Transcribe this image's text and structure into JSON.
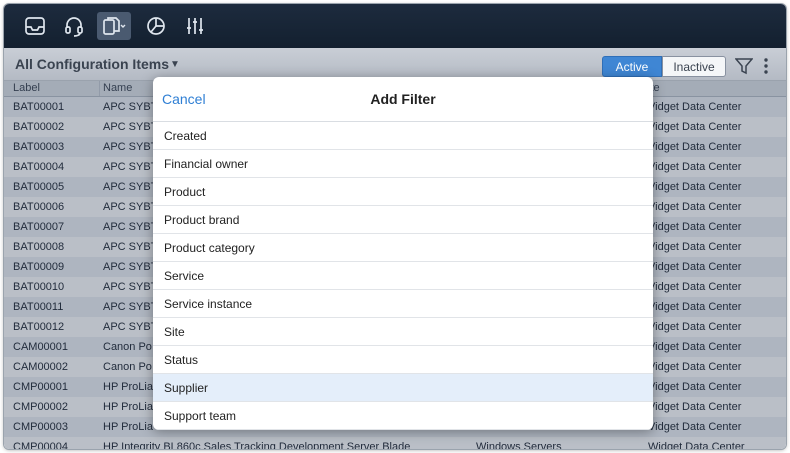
{
  "toolbar": {
    "icons": [
      "inbox-icon",
      "headset-icon",
      "copy-icon",
      "pie-chart-icon",
      "sliders-icon"
    ],
    "active_icon": "copy-icon"
  },
  "header": {
    "title": "All Configuration Items",
    "caret": "▼",
    "active_label": "Active",
    "inactive_label": "Inactive"
  },
  "table": {
    "columns": [
      "Label",
      "Name",
      "",
      "ite"
    ],
    "rows": [
      {
        "label": "BAT00001",
        "name": "APC SYBT",
        "type": "",
        "site": "Vidget Data Center"
      },
      {
        "label": "BAT00002",
        "name": "APC SYBT",
        "type": "",
        "site": "Vidget Data Center"
      },
      {
        "label": "BAT00003",
        "name": "APC SYBT",
        "type": "",
        "site": "Vidget Data Center"
      },
      {
        "label": "BAT00004",
        "name": "APC SYBT",
        "type": "",
        "site": "Vidget Data Center"
      },
      {
        "label": "BAT00005",
        "name": "APC SYBT",
        "type": "",
        "site": "Vidget Data Center"
      },
      {
        "label": "BAT00006",
        "name": "APC SYBT",
        "type": "",
        "site": "Vidget Data Center"
      },
      {
        "label": "BAT00007",
        "name": "APC SYBT",
        "type": "",
        "site": "Vidget Data Center"
      },
      {
        "label": "BAT00008",
        "name": "APC SYBT",
        "type": "",
        "site": "Vidget Data Center"
      },
      {
        "label": "BAT00009",
        "name": "APC SYBT",
        "type": "",
        "site": "Vidget Data Center"
      },
      {
        "label": "BAT00010",
        "name": "APC SYBT",
        "type": "",
        "site": "Vidget Data Center"
      },
      {
        "label": "BAT00011",
        "name": "APC SYBT",
        "type": "",
        "site": "Vidget Data Center"
      },
      {
        "label": "BAT00012",
        "name": "APC SYBT",
        "type": "",
        "site": "Vidget Data Center"
      },
      {
        "label": "CAM00001",
        "name": "Canon Po",
        "type": "",
        "site": "Vidget Data Center"
      },
      {
        "label": "CAM00002",
        "name": "Canon Po",
        "type": "",
        "site": "Vidget Data Center"
      },
      {
        "label": "CMP00001",
        "name": "HP ProLia",
        "type": "",
        "site": "Vidget Data Center"
      },
      {
        "label": "CMP00002",
        "name": "HP ProLia",
        "type": "",
        "site": "Vidget Data Center"
      },
      {
        "label": "CMP00003",
        "name": "HP ProLia",
        "type": "",
        "site": "Vidget Data Center"
      },
      {
        "label": "CMP00004",
        "name": "HP Integrity BL860c Sales Tracking Development Server Blade",
        "type": "Windows Servers",
        "site": "Widget Data Center"
      }
    ]
  },
  "popover": {
    "cancel_label": "Cancel",
    "title": "Add Filter",
    "items": [
      "Created",
      "Financial owner",
      "Product",
      "Product brand",
      "Product category",
      "Service",
      "Service instance",
      "Site",
      "Status",
      "Supplier",
      "Support team"
    ],
    "selected": "Supplier"
  },
  "colors": {
    "accent": "#3f86d4",
    "toolbar": "#1d2b3e",
    "link": "#2f7fd4"
  }
}
